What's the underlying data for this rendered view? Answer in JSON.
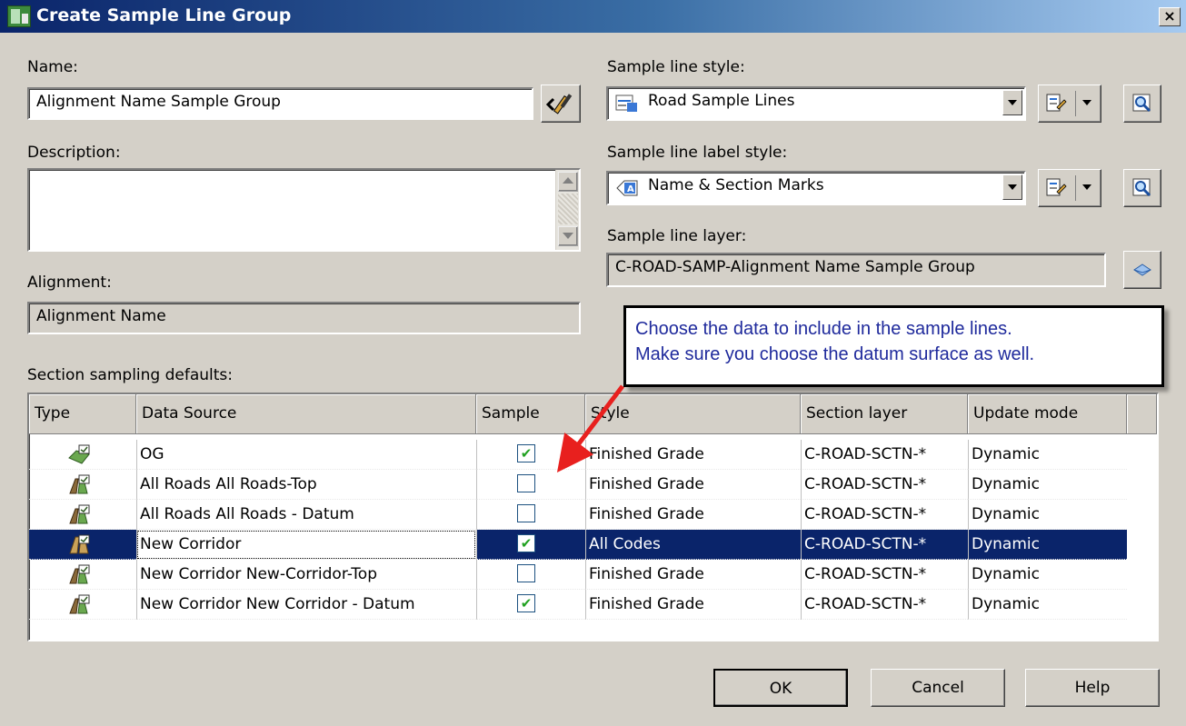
{
  "window": {
    "title": "Create Sample Line Group",
    "close_label": "×"
  },
  "name": {
    "label": "Name:",
    "value": "Alignment Name Sample Group"
  },
  "description": {
    "label": "Description:",
    "value": ""
  },
  "alignment": {
    "label": "Alignment:",
    "value": "Alignment Name"
  },
  "sample_line_style": {
    "label": "Sample line style:",
    "value": "Road Sample Lines"
  },
  "sample_line_label_style": {
    "label": "Sample line label style:",
    "value": "Name & Section Marks"
  },
  "sample_line_layer": {
    "label": "Sample line layer:",
    "value": "C-ROAD-SAMP-Alignment Name Sample Group"
  },
  "callout": {
    "line1": "Choose the data to include in the sample lines.",
    "line2": "Make sure you choose the datum surface as well.",
    "color": "#1f2a9c",
    "arrow_color": "#e8201e"
  },
  "sampling": {
    "label": "Section sampling defaults:",
    "columns": [
      "Type",
      "Data Source",
      "Sample",
      "Style",
      "Section layer",
      "Update mode"
    ],
    "rows": [
      {
        "type_icon": "surface-icon",
        "source": "OG",
        "sample": true,
        "style": "Finished Grade",
        "layer": "C-ROAD-SCTN-*",
        "mode": "Dynamic"
      },
      {
        "type_icon": "corridor-surface-icon",
        "source": "All Roads All Roads-Top",
        "sample": false,
        "style": "Finished Grade",
        "layer": "C-ROAD-SCTN-*",
        "mode": "Dynamic"
      },
      {
        "type_icon": "corridor-surface-icon",
        "source": "All Roads All Roads - Datum",
        "sample": false,
        "style": "Finished Grade",
        "layer": "C-ROAD-SCTN-*",
        "mode": "Dynamic"
      },
      {
        "type_icon": "corridor-icon",
        "source": "New Corridor",
        "sample": true,
        "style": "All Codes",
        "layer": "C-ROAD-SCTN-*",
        "mode": "Dynamic",
        "selected": true
      },
      {
        "type_icon": "corridor-surface-icon",
        "source": "New Corridor New-Corridor-Top",
        "sample": false,
        "style": "Finished Grade",
        "layer": "C-ROAD-SCTN-*",
        "mode": "Dynamic"
      },
      {
        "type_icon": "corridor-surface-icon",
        "source": "New Corridor New Corridor - Datum",
        "sample": true,
        "style": "Finished Grade",
        "layer": "C-ROAD-SCTN-*",
        "mode": "Dynamic"
      }
    ]
  },
  "buttons": {
    "ok": "OK",
    "cancel": "Cancel",
    "help": "Help"
  },
  "colors": {
    "dialog_bg": "#d4d0c8",
    "title_bar": "#0a246a",
    "selection": "#0a246a",
    "check_mark": "#21a121"
  }
}
